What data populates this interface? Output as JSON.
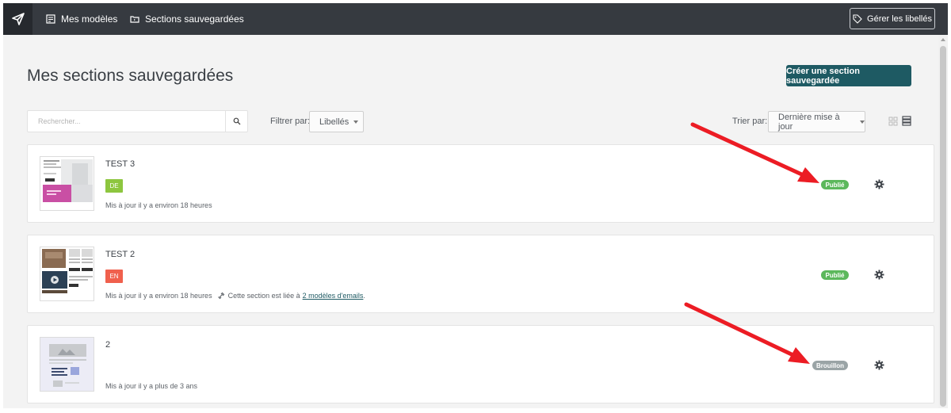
{
  "topbar": {
    "nav_models": "Mes modèles",
    "nav_sections": "Sections sauvegardées",
    "manage_labels": "Gérer les libellés"
  },
  "page": {
    "title": "Mes sections sauvegardées",
    "create_button": "Créer une section sauvegardée"
  },
  "filters": {
    "search_placeholder": "Rechercher...",
    "filter_label": "Filtrer par:",
    "filter_value": "Libellés",
    "sort_label": "Trier par:",
    "sort_value": "Dernière mise à jour"
  },
  "sections": [
    {
      "title": "TEST 3",
      "lang": "DE",
      "lang_color": "#8dc63f",
      "updated": "Mis à jour il y a environ 18 heures",
      "status": "Publié",
      "status_color": "#5cb85c"
    },
    {
      "title": "TEST 2",
      "lang": "EN",
      "lang_color": "#f0604d",
      "updated": "Mis à jour il y a environ 18 heures",
      "linked_text": "Cette section est liée à",
      "linked_link": "2 modèles d'emails",
      "linked_suffix": ".",
      "status": "Publié",
      "status_color": "#5cb85c"
    },
    {
      "title": "2",
      "updated": "Mis à jour il y a plus de 3 ans",
      "status": "Brouillon",
      "status_color": "#9aa4a6"
    }
  ],
  "colors": {
    "topbar": "#363a40",
    "accent": "#1e5a63",
    "annotation_arrow": "#ec1c24"
  },
  "icons": [
    "paper-plane-icon",
    "template-icon",
    "folder-icon",
    "tag-icon",
    "search-icon",
    "grid-view-icon",
    "list-view-icon",
    "gear-icon",
    "link-icon"
  ]
}
